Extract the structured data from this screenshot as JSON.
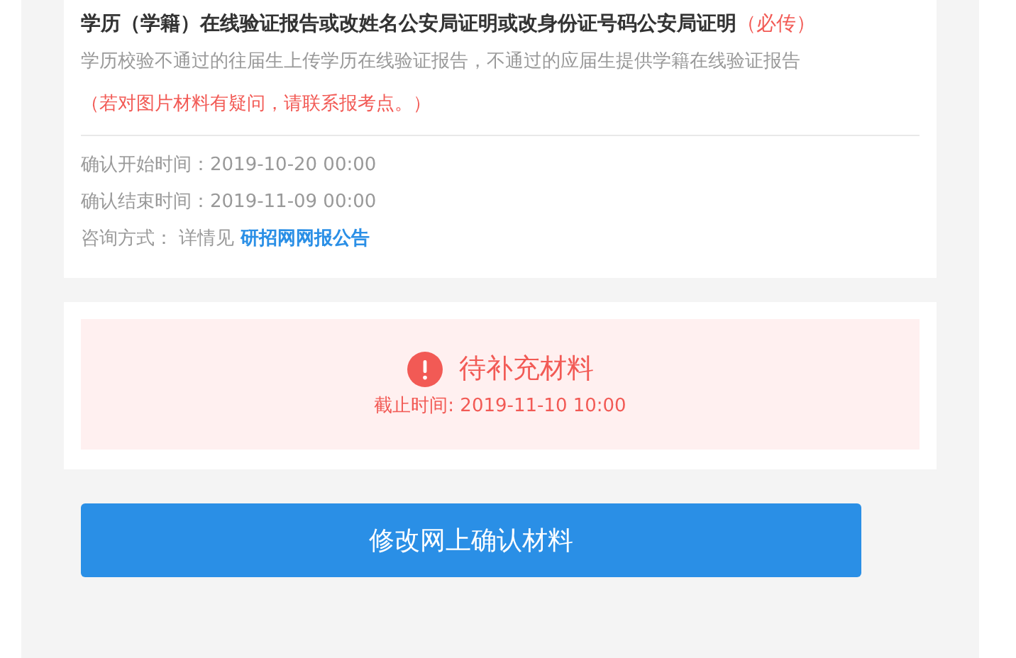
{
  "material": {
    "title": "学历（学籍）在线验证报告或改姓名公安局证明或改身份证号码公安局证明",
    "required_note": "（必传）",
    "description": "学历校验不通过的往届生上传学历在线验证报告，不通过的应届生提供学籍在线验证报告",
    "notice": "（若对图片材料有疑问，请联系报考点。）"
  },
  "info": [
    {
      "label": "确认开始时间：",
      "value": "2019-10-20 00:00"
    },
    {
      "label": "确认结束时间：",
      "value": "2019-11-09 00:00"
    }
  ],
  "contact": {
    "label": "咨询方式：",
    "prefix": "详情见",
    "link": "研招网网报公告"
  },
  "status": {
    "text": "待补充材料",
    "deadline": "截止时间: 2019-11-10 10:00"
  },
  "button": "修改网上确认材料"
}
